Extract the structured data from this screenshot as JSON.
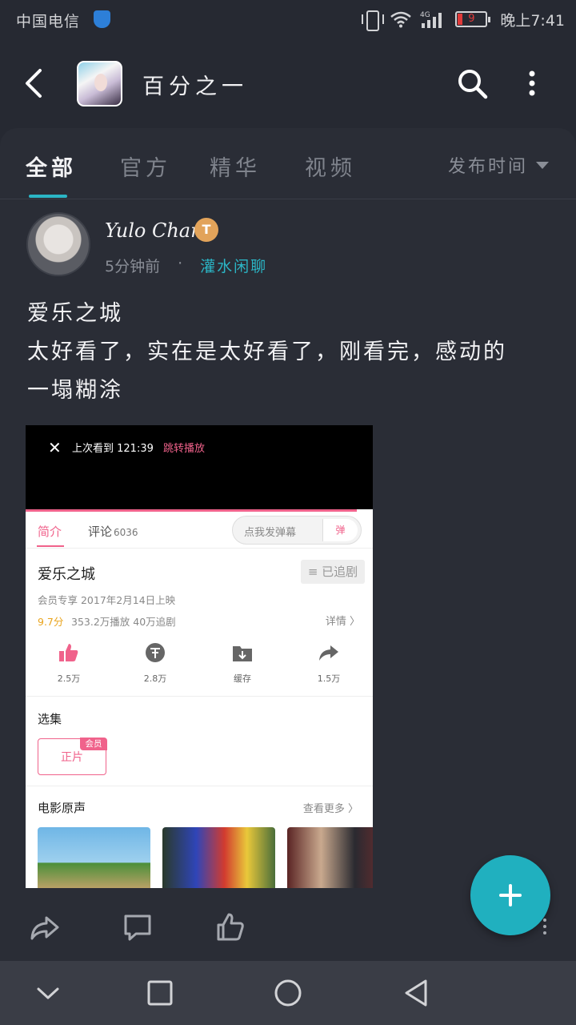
{
  "status_bar": {
    "carrier": "中国电信",
    "battery_level": "9",
    "time": "晚上7:41",
    "network": "4G"
  },
  "header": {
    "group_title": "百分之一"
  },
  "tabs": {
    "items": [
      "全部",
      "官方",
      "精华",
      "视频"
    ],
    "active_index": 0,
    "sort_label": "发布时间"
  },
  "post": {
    "username": "Yulo Chan",
    "level_badge": "T",
    "time_ago": "5分钟前",
    "separator": "·",
    "category": "灌水闲聊",
    "text_lines": [
      "爱乐之城",
      "太好看了，实在是太好看了，刚看完，感动的",
      "一塌糊涂"
    ]
  },
  "screenshot": {
    "close": "✕",
    "resume": "上次看到 121:39",
    "jump": "跳转播放",
    "tab_intro": "简介",
    "tab_comment": "评论",
    "comment_count": "6036",
    "danmaku_placeholder": "点我发弹幕",
    "danmaku_button": "弹",
    "title": "爱乐之城",
    "follow_label": "≡ 已追剧",
    "info": "会员专享   2017年2月14日上映",
    "score": "9.7分",
    "stats": "353.2万播放   40万追剧",
    "detail": "详情 〉",
    "actions": [
      {
        "icon": "thumbs-up-icon",
        "label": "2.5万"
      },
      {
        "icon": "coin-icon",
        "label": "2.8万"
      },
      {
        "icon": "download-folder-icon",
        "label": "缓存"
      },
      {
        "icon": "share-arrow-icon",
        "label": "1.5万"
      }
    ],
    "episodes_title": "选集",
    "episode_label": "正片",
    "member_badge": "会员",
    "ost_title": "电影原声",
    "see_more": "查看更多 〉"
  },
  "colors": {
    "accent": "#2bb5c5",
    "background": "#262932",
    "pink": "#f0628b"
  }
}
